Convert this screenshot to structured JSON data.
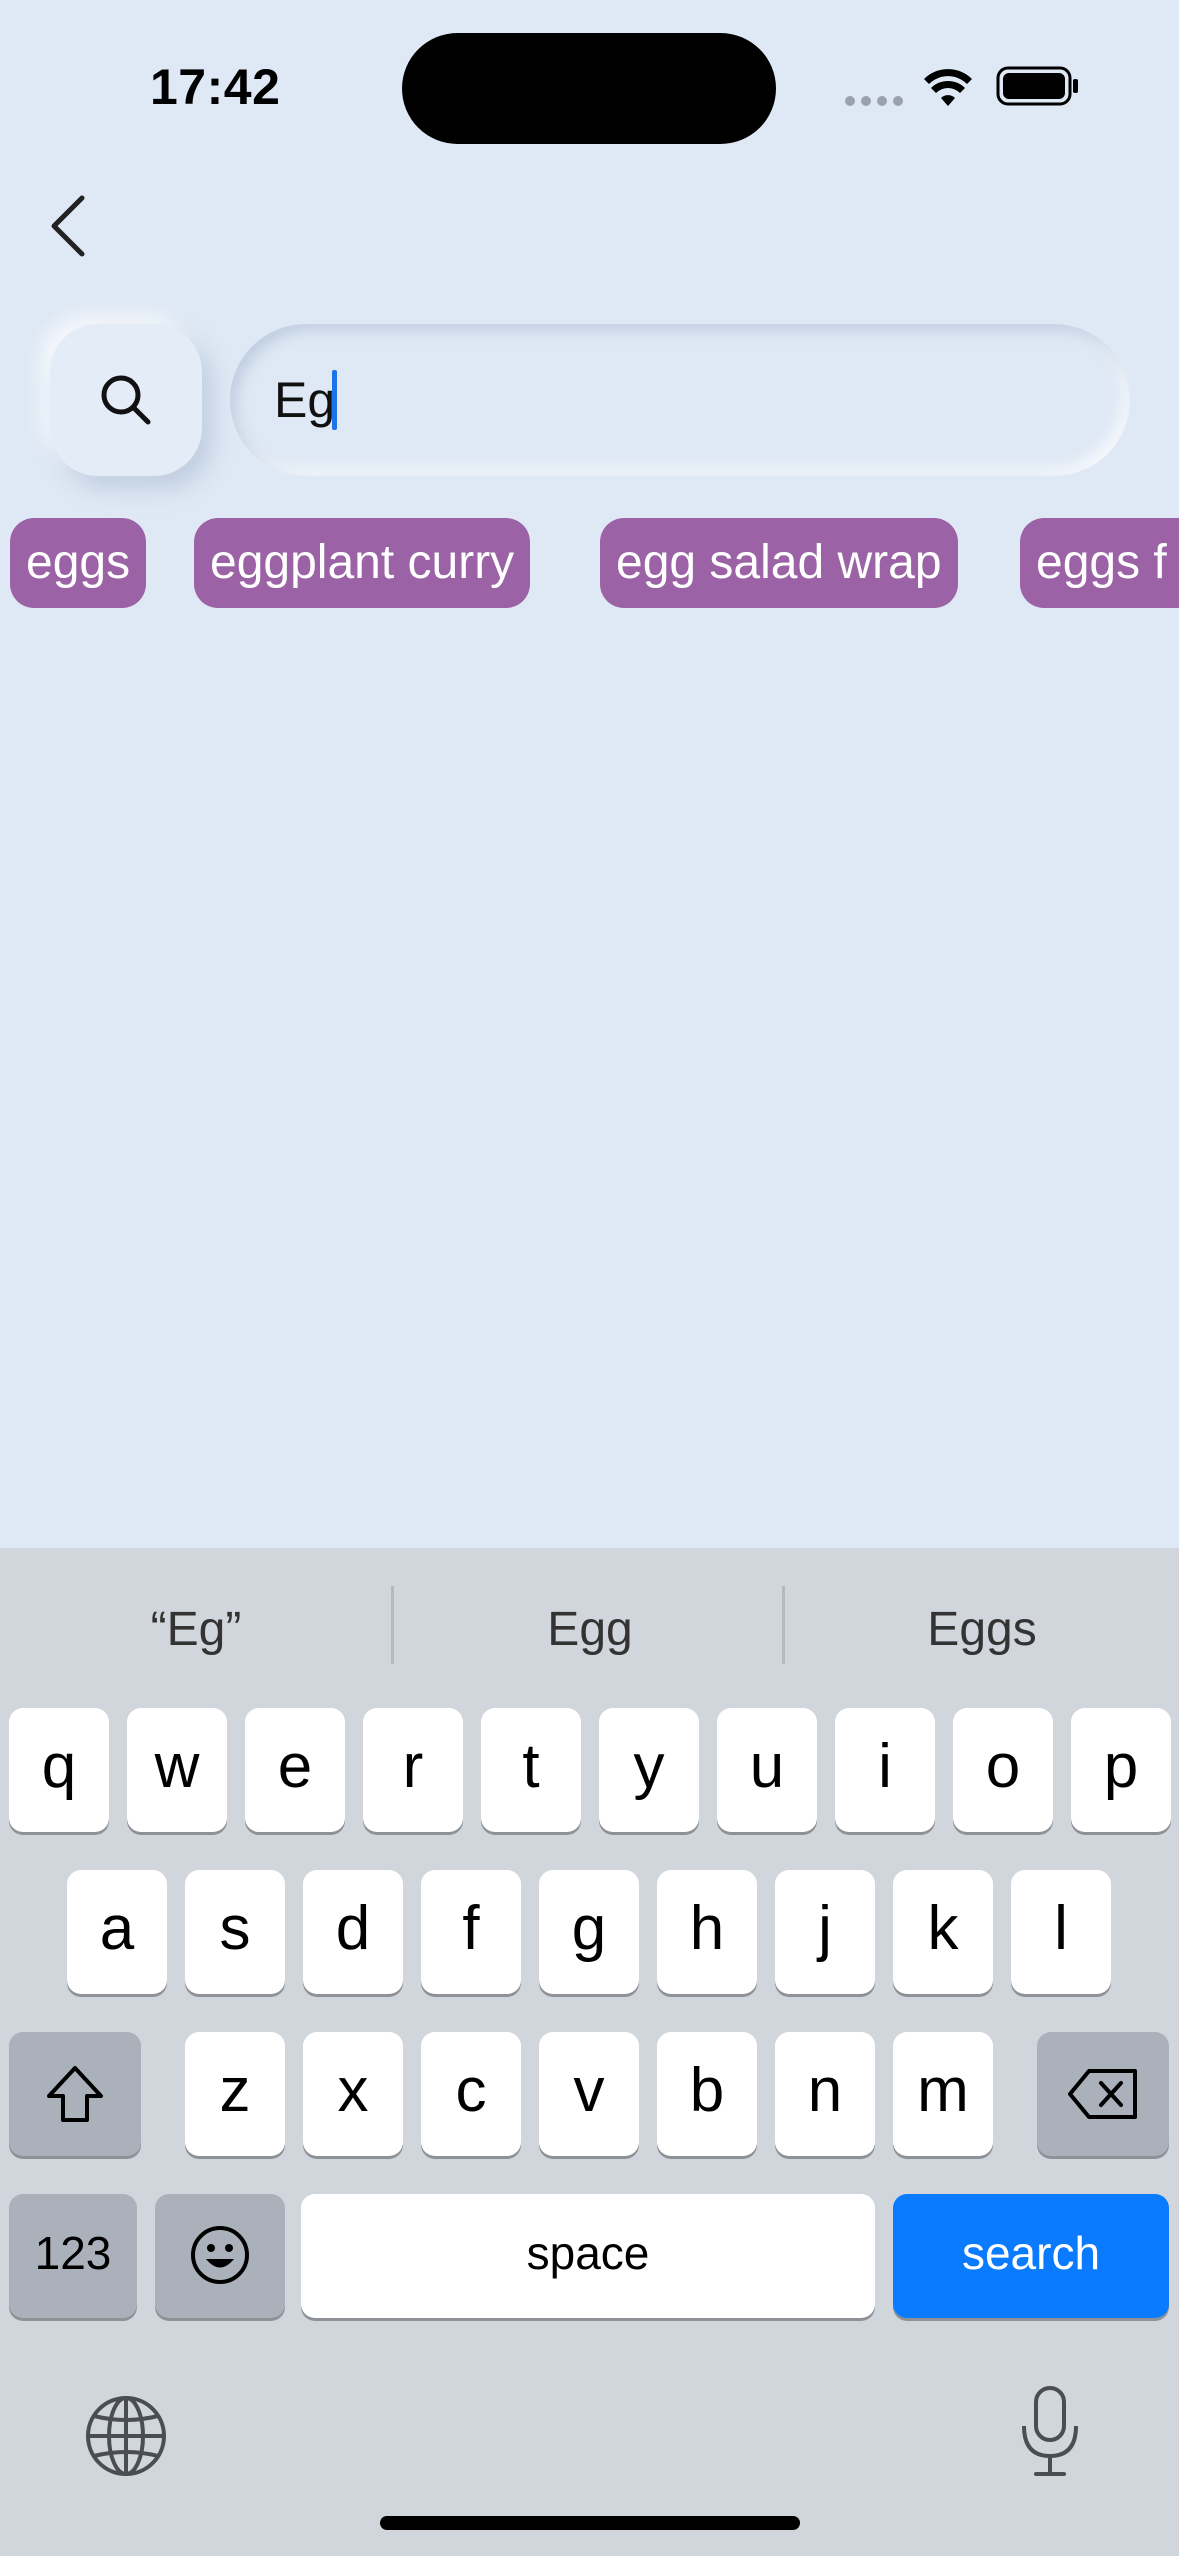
{
  "status": {
    "time": "17:42"
  },
  "search": {
    "value": "Eg",
    "placeholder": ""
  },
  "chips": [
    "eggs",
    "eggplant curry",
    "egg salad wrap",
    "eggs f"
  ],
  "keyboard": {
    "suggestions": [
      "“Eg”",
      "Egg",
      "Eggs"
    ],
    "row1": [
      "q",
      "w",
      "e",
      "r",
      "t",
      "y",
      "u",
      "i",
      "o",
      "p"
    ],
    "row2": [
      "a",
      "s",
      "d",
      "f",
      "g",
      "h",
      "j",
      "k",
      "l"
    ],
    "row3": [
      "z",
      "x",
      "c",
      "v",
      "b",
      "n",
      "m"
    ],
    "numbers_label": "123",
    "space_label": "space",
    "search_label": "search"
  },
  "colors": {
    "background": "#dfe9f5",
    "chip": "#9b63a6",
    "search_key": "#0a7bff",
    "keyboard": "#d1d5dc"
  }
}
